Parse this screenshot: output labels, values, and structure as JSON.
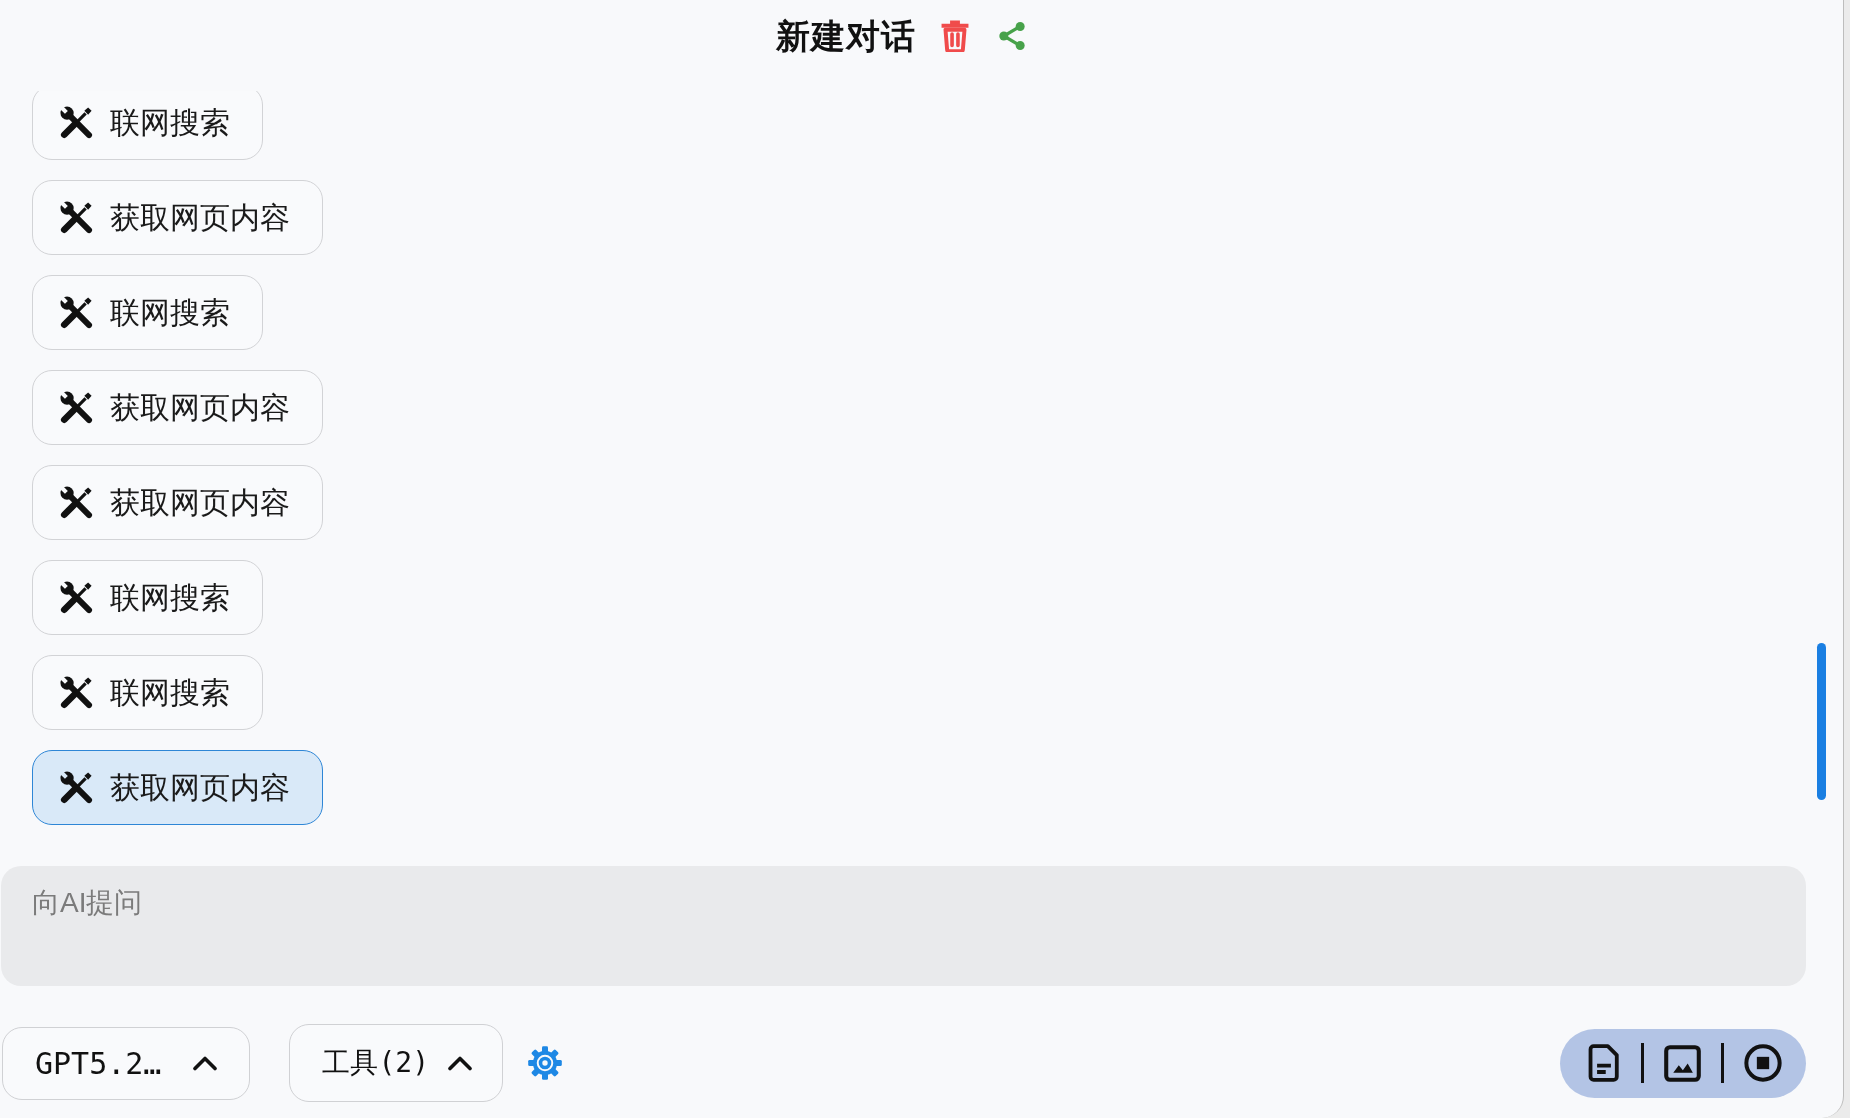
{
  "header": {
    "title": "新建对话"
  },
  "tool_calls": [
    {
      "label": "联网搜索",
      "selected": false
    },
    {
      "label": "获取网页内容",
      "selected": false
    },
    {
      "label": "联网搜索",
      "selected": false
    },
    {
      "label": "获取网页内容",
      "selected": false
    },
    {
      "label": "获取网页内容",
      "selected": false
    },
    {
      "label": "联网搜索",
      "selected": false
    },
    {
      "label": "联网搜索",
      "selected": false
    },
    {
      "label": "获取网页内容",
      "selected": true
    }
  ],
  "prompt_input": {
    "placeholder": "向AI提问"
  },
  "model_selector": {
    "label": "GPT5.2…"
  },
  "tools_selector": {
    "label": "工具(2)"
  }
}
